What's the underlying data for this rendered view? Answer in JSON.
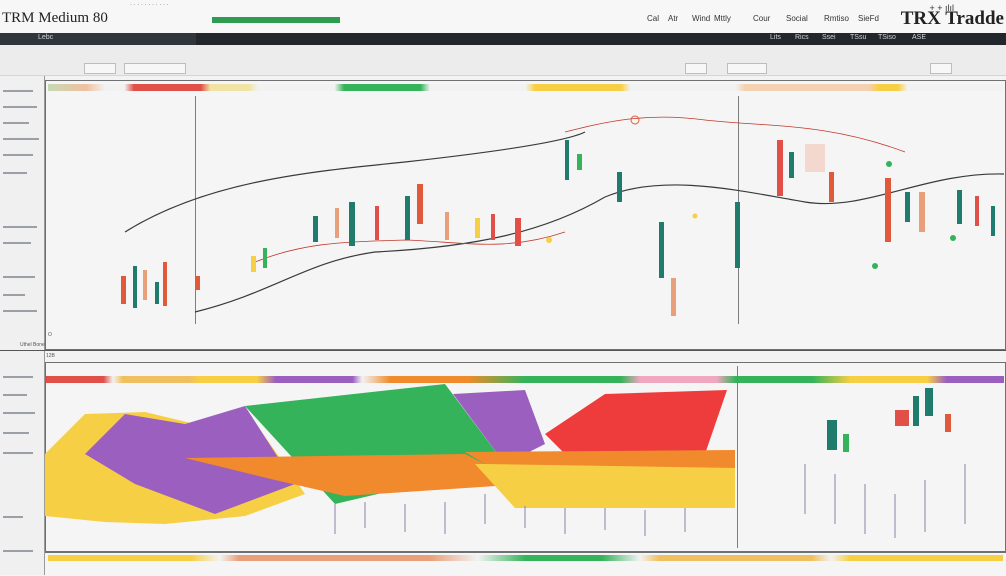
{
  "app": {
    "title": "TRM Medium 80",
    "brand": "TRX Tradde",
    "brand_icon": "+ + ılıl"
  },
  "top_menu": [
    "Cal",
    "Atr",
    "Wind",
    "Mttly",
    "Cour",
    "Social",
    "Rmtiso",
    "SieFd"
  ],
  "toolbar": {
    "left_label": "Lebc",
    "right_items": [
      "Lits",
      "Rics",
      "Ssei",
      "TSsu",
      "TSiso",
      "ASE"
    ]
  },
  "main_chart": {
    "status_label": "Uthel Bone",
    "marker": "O"
  },
  "lower_panel": {
    "label": "12B"
  },
  "colors": {
    "accent_green": "#2e9b53",
    "candle_up": "#e0593a",
    "candle_down": "#1f7c6d",
    "area_purple": "#9b5fc0",
    "area_yellow": "#f7cf45",
    "area_orange": "#f08a2c",
    "area_green": "#35b35a",
    "area_red": "#ee3b3b"
  },
  "icons": [
    "plus-icon",
    "bar-chart-icon",
    "menu-icon"
  ]
}
